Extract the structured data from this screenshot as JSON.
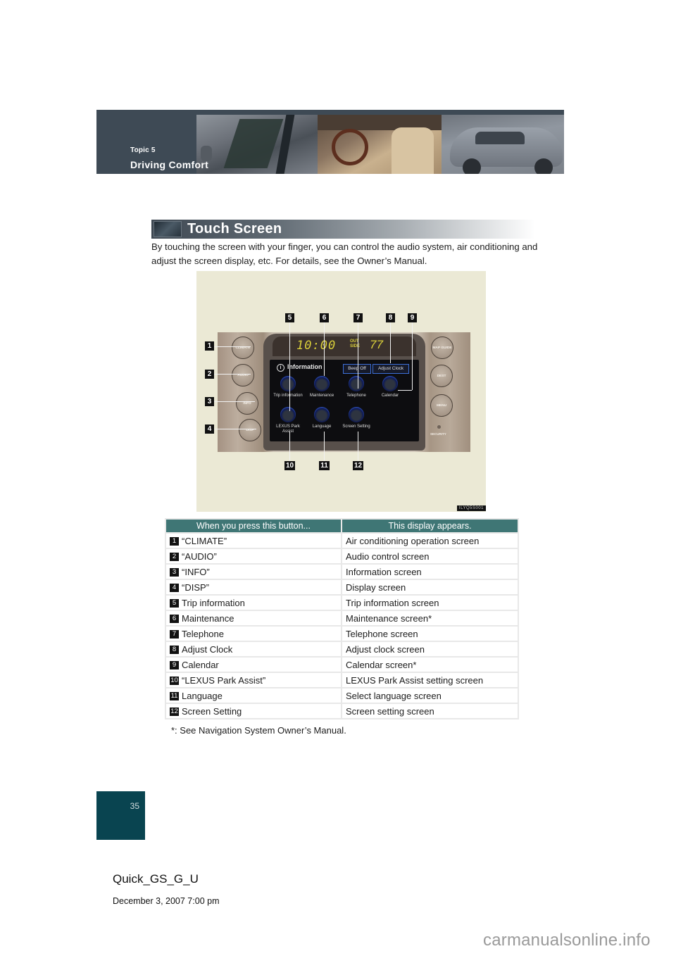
{
  "header": {
    "topic": "Topic 5",
    "title": "Driving Comfort"
  },
  "section": {
    "title": "Touch Screen",
    "intro": "By touching the screen with your finger, you can control the audio system, air conditioning and adjust the screen display, etc. For details, see the Owner’s Manual."
  },
  "illustration": {
    "clock": "10:00",
    "outside_label": "OUT SIDE",
    "outside_temp": "77",
    "screen_title": "Information",
    "beep_button": "Beep Off",
    "adjust_clock_button": "Adjust Clock",
    "left_buttons": [
      "CLIMATE",
      "AUDIO",
      "INFO",
      "DISP"
    ],
    "right_buttons": [
      "MAP GUIDE",
      "DEST",
      "MENU"
    ],
    "security_label": "SECURITY",
    "icons": [
      {
        "label": "Trip information",
        "icon": "wheel-icon"
      },
      {
        "label": "Maintenance",
        "icon": "wrench-icon"
      },
      {
        "label": "Telephone",
        "icon": "phone-icon"
      },
      {
        "label": "Calendar",
        "icon": "calendar-icon"
      },
      {
        "label": "LEXUS Park Assist",
        "icon": "park-assist-icon"
      },
      {
        "label": "Language",
        "icon": "book-icon"
      },
      {
        "label": "Screen Setting",
        "icon": "screen-icon"
      }
    ],
    "callouts": [
      "1",
      "2",
      "3",
      "4",
      "5",
      "6",
      "7",
      "8",
      "9",
      "10",
      "11",
      "12"
    ],
    "figure_code": "ILYQ5S001"
  },
  "table": {
    "headers": [
      "When you press this button...",
      "This display appears."
    ],
    "rows": [
      {
        "num": "1",
        "button": "“CLIMATE”",
        "display": "Air conditioning operation screen"
      },
      {
        "num": "2",
        "button": "“AUDIO”",
        "display": "Audio control screen"
      },
      {
        "num": "3",
        "button": "“INFO”",
        "display": "Information screen"
      },
      {
        "num": "4",
        "button": "“DISP”",
        "display": "Display screen"
      },
      {
        "num": "5",
        "button": "Trip information",
        "display": "Trip information screen"
      },
      {
        "num": "6",
        "button": "Maintenance",
        "display": "Maintenance screen*"
      },
      {
        "num": "7",
        "button": "Telephone",
        "display": "Telephone screen"
      },
      {
        "num": "8",
        "button": "Adjust Clock",
        "display": "Adjust clock screen"
      },
      {
        "num": "9",
        "button": "Calendar",
        "display": "Calendar screen*"
      },
      {
        "num": "10",
        "button": "“LEXUS Park Assist”",
        "display": "LEXUS Park Assist setting screen"
      },
      {
        "num": "11",
        "button": "Language",
        "display": "Select language screen"
      },
      {
        "num": "12",
        "button": "Screen Setting",
        "display": "Screen setting screen"
      }
    ]
  },
  "footnote": "*: See Navigation System Owner’s Manual.",
  "page_number": "35",
  "footer": {
    "doc_name": "Quick_GS_G_U",
    "date": "December 3, 2007 7:00 pm",
    "watermark": "carmanualsonline.info"
  },
  "colors": {
    "banner": "#3e4a55",
    "table_header": "#3f7675",
    "page_box": "#094450",
    "illustration_bg": "#ebe9d5"
  }
}
